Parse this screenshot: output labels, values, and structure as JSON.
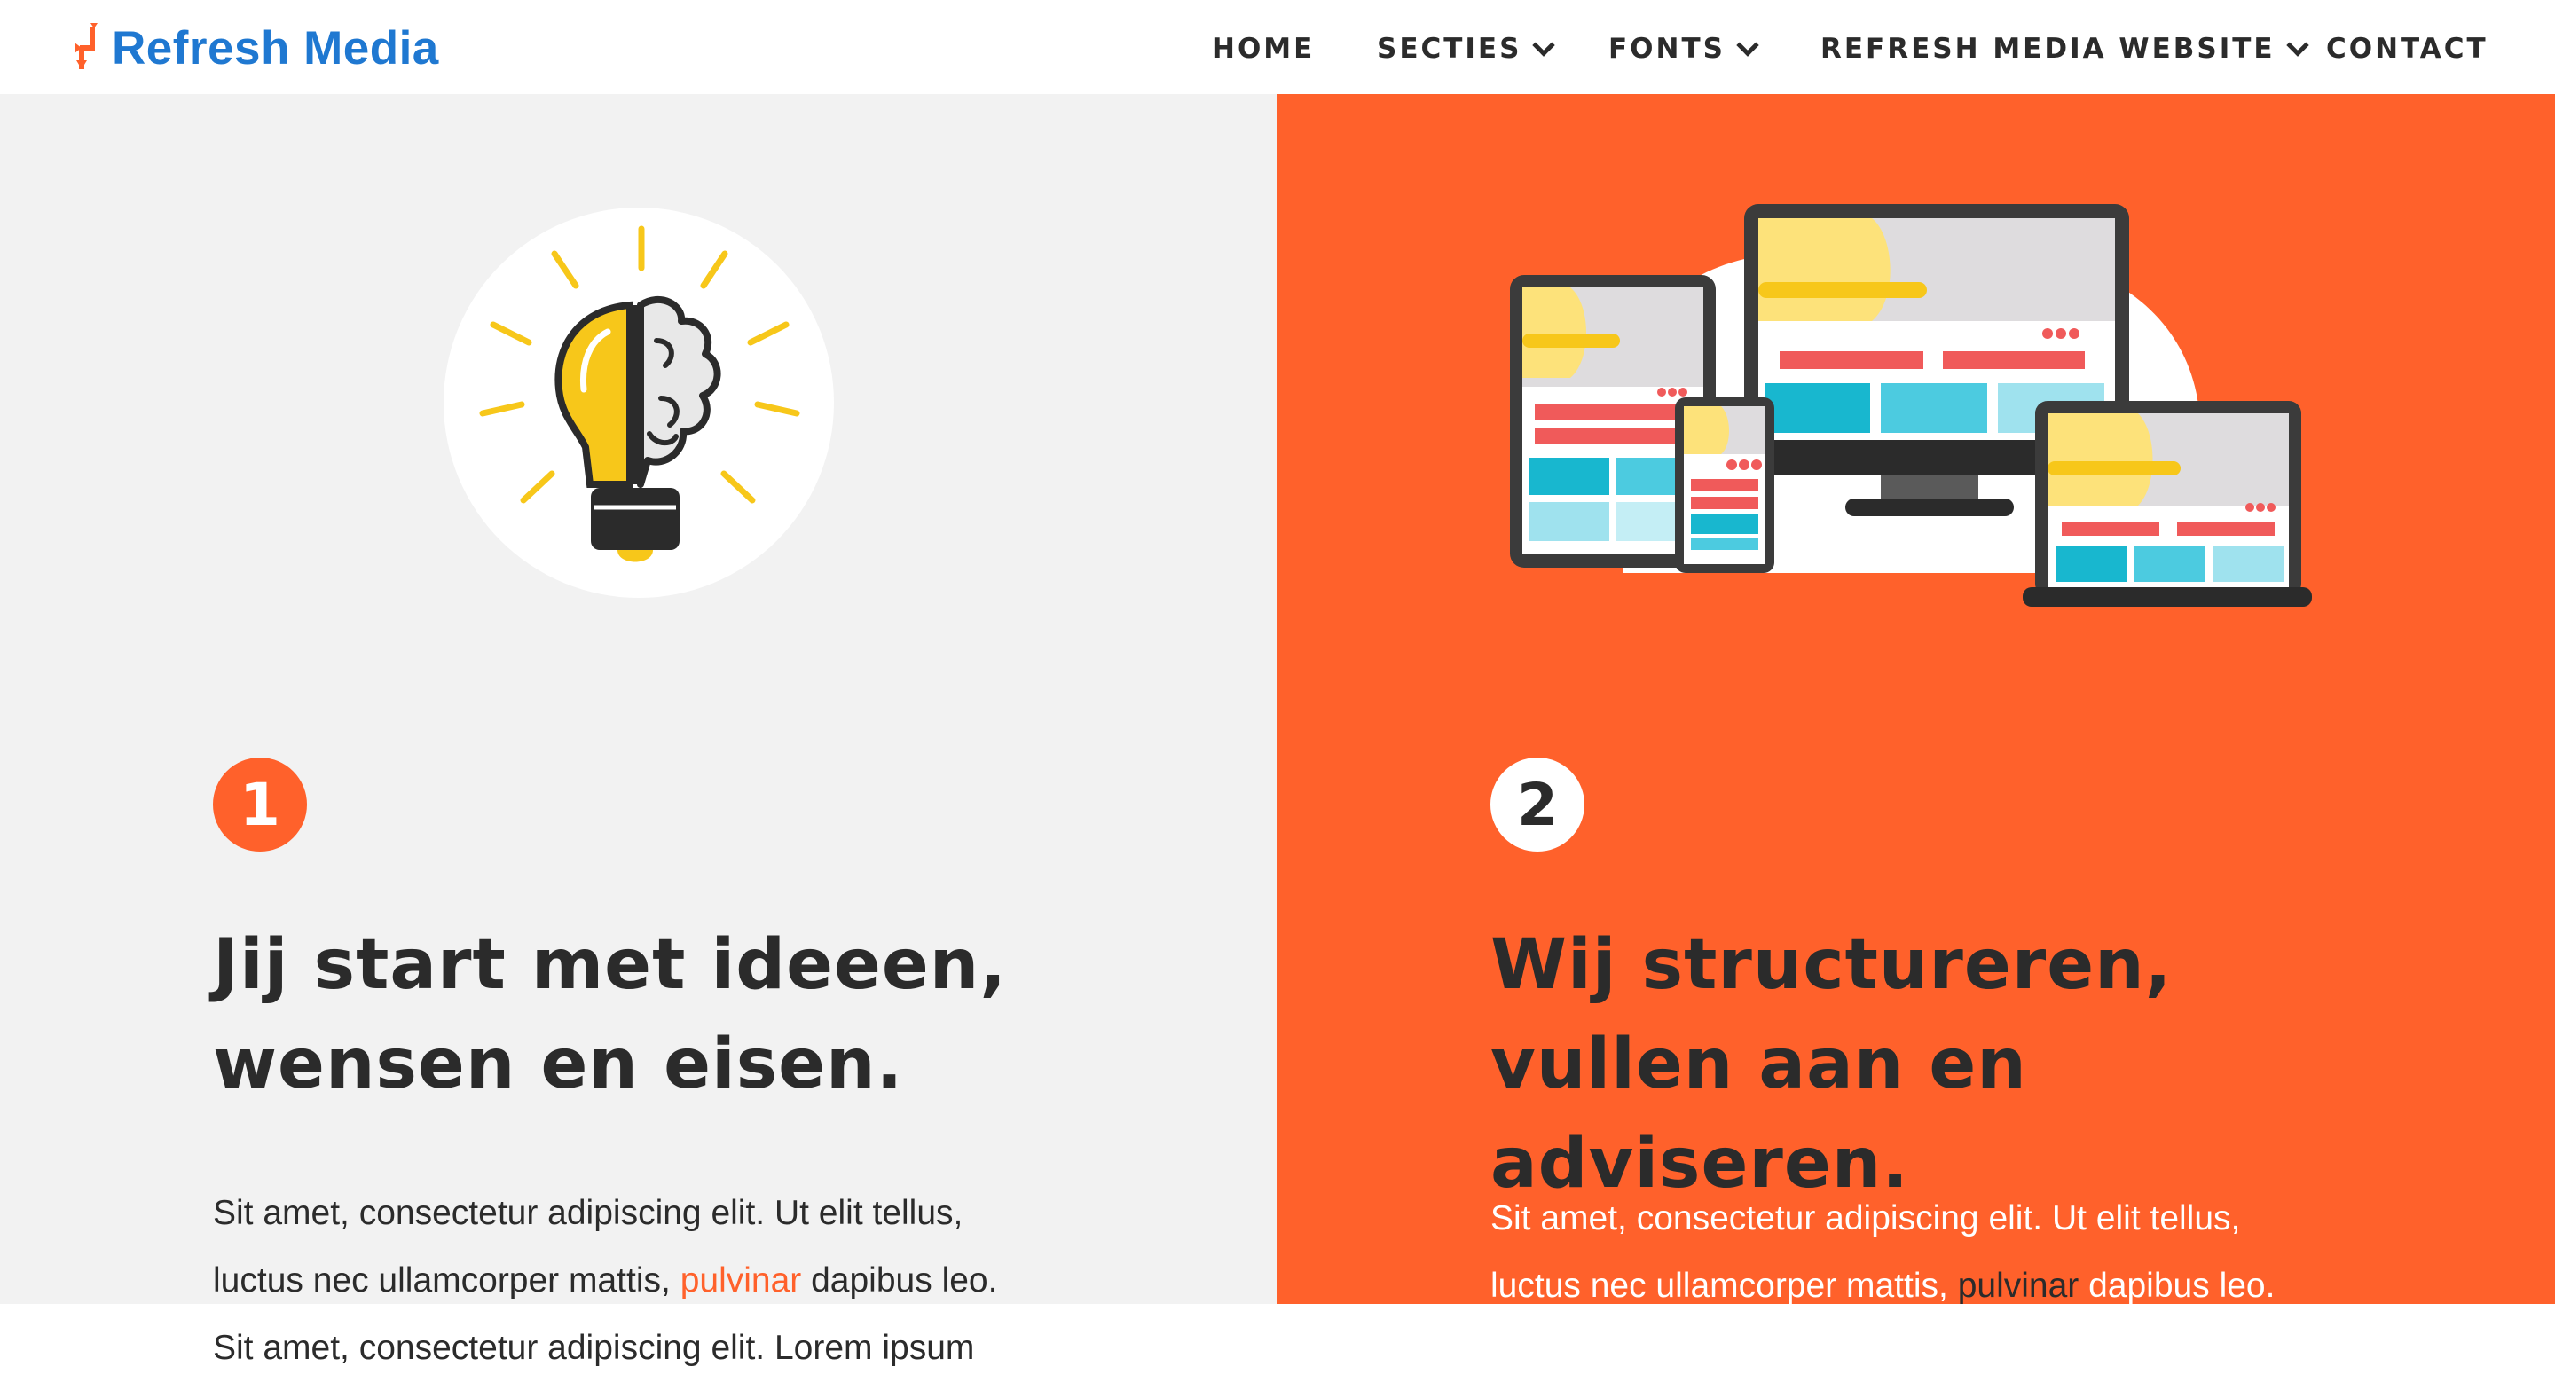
{
  "brand": {
    "name": "Refresh Media",
    "color": "#1f78d1",
    "accent": "#ff612b"
  },
  "nav": {
    "items": [
      {
        "label": "HOME",
        "has_dropdown": false
      },
      {
        "label": "SECTIES",
        "has_dropdown": true
      },
      {
        "label": "FONTS",
        "has_dropdown": true
      },
      {
        "label": "REFRESH MEDIA WEBSITE",
        "has_dropdown": true
      },
      {
        "label": "CONTACT",
        "has_dropdown": false
      }
    ]
  },
  "steps": [
    {
      "number": "1",
      "icon": "lightbulb-brain-icon",
      "heading_lines": [
        "Jij start met ideeen,",
        "wensen en eisen."
      ],
      "para": {
        "line1": "Sit amet, consectetur adipiscing elit. Ut elit tellus,",
        "line2_before": "luctus nec ullamcorper mattis, ",
        "line2_link": "pulvinar",
        "line2_after": " dapibus leo.",
        "line3": "Sit amet, consectetur adipiscing elit. Lorem ipsum"
      }
    },
    {
      "number": "2",
      "icon": "responsive-devices-icon",
      "heading_lines": [
        "Wij structureren,",
        "vullen aan en",
        "adviseren."
      ],
      "para": {
        "line1": "Sit amet, consectetur adipiscing elit. Ut elit tellus,",
        "line2_before": "luctus nec ullamcorper mattis, ",
        "line2_link": "pulvinar",
        "line2_after": " dapibus leo."
      }
    }
  ]
}
